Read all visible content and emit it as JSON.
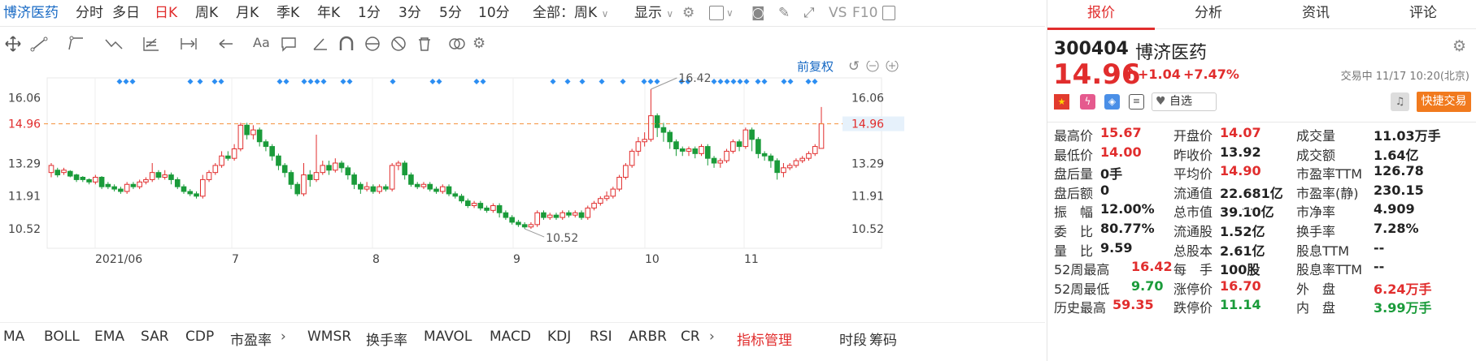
{
  "toolbar": {
    "stock_name": "博济医药",
    "periods": [
      "分时",
      "多日",
      "日K",
      "周K",
      "月K",
      "季K",
      "年K",
      "1分",
      "3分",
      "5分",
      "10分"
    ],
    "active_period": "日K",
    "all_select": "全部：周K",
    "display_label": "显示",
    "vs_label": "VS",
    "f10_label": "F10"
  },
  "chart": {
    "adjust_label": "前复权",
    "price_left": [
      "16.06",
      "14.96",
      "13.29",
      "11.91",
      "10.52"
    ],
    "price_right": [
      "16.06",
      "14.96",
      "13.29",
      "11.91",
      "10.52"
    ],
    "current_price_line": "14.96",
    "high_marker": "16.42",
    "low_marker": "10.52",
    "x_labels": [
      "2021/06",
      "7",
      "8",
      "9",
      "10",
      "11"
    ]
  },
  "chart_data": {
    "type": "candlestick",
    "current_price": 14.96,
    "ylim": [
      9.7,
      16.9
    ],
    "max_label": 16.42,
    "min_label": 10.52,
    "candles": [
      [
        12.9,
        13.2,
        13.3,
        12.7
      ],
      [
        13.0,
        12.8,
        13.1,
        12.7
      ],
      [
        12.9,
        13.0,
        13.1,
        12.8
      ],
      [
        12.95,
        12.75,
        13.0,
        12.7
      ],
      [
        12.8,
        12.6,
        12.85,
        12.5
      ],
      [
        12.7,
        12.6,
        12.75,
        12.5
      ],
      [
        12.6,
        12.5,
        12.65,
        12.4
      ],
      [
        12.5,
        12.7,
        12.8,
        12.4
      ],
      [
        12.7,
        12.3,
        12.75,
        12.2
      ],
      [
        12.4,
        12.3,
        12.5,
        12.2
      ],
      [
        12.3,
        12.2,
        12.4,
        12.1
      ],
      [
        12.2,
        12.1,
        12.3,
        12.0
      ],
      [
        12.1,
        12.4,
        12.5,
        12.0
      ],
      [
        12.4,
        12.3,
        12.5,
        12.2
      ],
      [
        12.3,
        12.5,
        12.6,
        12.2
      ],
      [
        12.5,
        12.6,
        12.7,
        12.4
      ],
      [
        12.6,
        12.9,
        13.3,
        12.5
      ],
      [
        12.9,
        12.7,
        13.0,
        12.6
      ],
      [
        12.7,
        12.8,
        13.0,
        12.6
      ],
      [
        12.8,
        12.6,
        12.9,
        12.4
      ],
      [
        12.6,
        12.3,
        12.7,
        12.2
      ],
      [
        12.3,
        12.1,
        12.4,
        12.0
      ],
      [
        12.1,
        12.0,
        12.2,
        11.9
      ],
      [
        12.0,
        11.9,
        12.1,
        11.8
      ],
      [
        11.9,
        12.6,
        12.8,
        11.8
      ],
      [
        12.6,
        12.9,
        13.0,
        12.5
      ],
      [
        12.9,
        13.2,
        13.3,
        12.8
      ],
      [
        13.2,
        13.6,
        13.8,
        13.1
      ],
      [
        13.6,
        13.5,
        13.8,
        13.4
      ],
      [
        13.5,
        13.9,
        14.1,
        13.4
      ],
      [
        13.9,
        14.9,
        15.0,
        13.8
      ],
      [
        14.9,
        14.5,
        15.0,
        14.3
      ],
      [
        14.5,
        14.7,
        14.9,
        14.3
      ],
      [
        14.7,
        14.2,
        14.8,
        14.0
      ],
      [
        14.2,
        14.0,
        14.3,
        13.8
      ],
      [
        14.0,
        13.6,
        14.1,
        13.4
      ],
      [
        13.6,
        13.2,
        13.7,
        13.0
      ],
      [
        13.2,
        12.9,
        13.3,
        12.7
      ],
      [
        12.9,
        12.4,
        13.0,
        12.2
      ],
      [
        12.4,
        12.0,
        12.5,
        11.9
      ],
      [
        12.0,
        12.8,
        13.3,
        11.9
      ],
      [
        12.8,
        12.6,
        13.0,
        12.3
      ],
      [
        12.6,
        12.9,
        14.5,
        12.5
      ],
      [
        12.9,
        13.2,
        13.4,
        12.8
      ],
      [
        13.2,
        13.0,
        13.4,
        12.8
      ],
      [
        13.0,
        13.3,
        13.5,
        12.9
      ],
      [
        13.3,
        13.1,
        13.4,
        12.9
      ],
      [
        13.1,
        12.8,
        13.2,
        12.6
      ],
      [
        12.8,
        12.4,
        12.9,
        12.2
      ],
      [
        12.4,
        12.2,
        12.5,
        12.0
      ],
      [
        12.2,
        12.3,
        12.5,
        12.1
      ],
      [
        12.3,
        12.1,
        12.4,
        12.0
      ],
      [
        12.1,
        12.3,
        12.4,
        12.0
      ],
      [
        12.3,
        12.2,
        12.4,
        12.1
      ],
      [
        12.2,
        13.2,
        13.3,
        12.1
      ],
      [
        13.2,
        13.3,
        13.4,
        13.0
      ],
      [
        13.3,
        12.8,
        13.4,
        12.6
      ],
      [
        12.8,
        12.4,
        12.9,
        12.3
      ],
      [
        12.4,
        12.3,
        12.5,
        12.2
      ],
      [
        12.3,
        12.4,
        12.5,
        12.2
      ],
      [
        12.4,
        12.2,
        12.5,
        12.1
      ],
      [
        12.2,
        12.1,
        12.3,
        12.0
      ],
      [
        12.1,
        12.3,
        12.4,
        12.0
      ],
      [
        12.3,
        12.0,
        12.4,
        11.9
      ],
      [
        12.0,
        11.9,
        12.1,
        11.8
      ],
      [
        11.9,
        11.7,
        12.0,
        11.6
      ],
      [
        11.7,
        11.5,
        11.8,
        11.4
      ],
      [
        11.5,
        11.6,
        11.7,
        11.4
      ],
      [
        11.6,
        11.4,
        11.7,
        11.3
      ],
      [
        11.4,
        11.3,
        11.5,
        11.2
      ],
      [
        11.3,
        11.5,
        11.6,
        11.2
      ],
      [
        11.5,
        11.2,
        11.6,
        11.0
      ],
      [
        11.2,
        11.0,
        11.3,
        10.9
      ],
      [
        11.0,
        10.8,
        11.1,
        10.7
      ],
      [
        10.8,
        10.7,
        10.9,
        10.6
      ],
      [
        10.7,
        10.6,
        10.8,
        10.52
      ],
      [
        10.6,
        10.7,
        10.8,
        10.52
      ],
      [
        10.7,
        11.2,
        11.3,
        10.6
      ],
      [
        11.2,
        11.0,
        11.3,
        10.9
      ],
      [
        11.0,
        11.1,
        11.2,
        10.9
      ],
      [
        11.1,
        11.0,
        11.2,
        10.9
      ],
      [
        11.0,
        11.2,
        11.3,
        10.9
      ],
      [
        11.2,
        11.1,
        11.3,
        11.0
      ],
      [
        11.1,
        11.2,
        11.3,
        11.0
      ],
      [
        11.2,
        11.0,
        11.3,
        10.9
      ],
      [
        11.0,
        11.4,
        11.5,
        10.9
      ],
      [
        11.4,
        11.6,
        11.7,
        11.3
      ],
      [
        11.6,
        11.8,
        11.9,
        11.5
      ],
      [
        11.8,
        11.9,
        12.1,
        11.7
      ],
      [
        11.9,
        12.2,
        12.3,
        11.8
      ],
      [
        12.2,
        12.7,
        12.8,
        12.1
      ],
      [
        12.7,
        13.2,
        13.3,
        12.6
      ],
      [
        13.2,
        13.8,
        13.9,
        13.1
      ],
      [
        13.8,
        14.2,
        14.4,
        13.6
      ],
      [
        14.2,
        14.3,
        14.6,
        14.0
      ],
      [
        14.3,
        15.3,
        16.42,
        14.2
      ],
      [
        15.3,
        14.8,
        15.4,
        14.4
      ],
      [
        14.8,
        14.6,
        15.0,
        14.2
      ],
      [
        14.6,
        14.2,
        14.7,
        13.9
      ],
      [
        14.2,
        13.9,
        14.3,
        13.6
      ],
      [
        13.9,
        13.8,
        14.0,
        13.6
      ],
      [
        13.8,
        13.9,
        14.0,
        13.6
      ],
      [
        13.9,
        13.7,
        14.0,
        13.5
      ],
      [
        13.7,
        14.0,
        14.1,
        13.6
      ],
      [
        14.0,
        13.5,
        14.1,
        13.2
      ],
      [
        13.5,
        13.3,
        13.6,
        13.1
      ],
      [
        13.3,
        13.4,
        13.5,
        13.1
      ],
      [
        13.4,
        13.8,
        13.9,
        13.3
      ],
      [
        13.8,
        14.2,
        14.3,
        13.7
      ],
      [
        14.2,
        14.0,
        14.3,
        13.8
      ],
      [
        14.0,
        14.7,
        14.8,
        13.9
      ],
      [
        14.7,
        14.3,
        14.8,
        13.8
      ],
      [
        14.3,
        13.7,
        14.4,
        13.5
      ],
      [
        13.7,
        13.6,
        13.8,
        13.4
      ],
      [
        13.6,
        13.4,
        13.7,
        13.1
      ],
      [
        13.4,
        12.9,
        13.5,
        12.6
      ],
      [
        12.9,
        13.1,
        13.3,
        12.7
      ],
      [
        13.1,
        13.2,
        13.3,
        13.0
      ],
      [
        13.2,
        13.4,
        13.5,
        13.1
      ],
      [
        13.4,
        13.5,
        13.6,
        13.3
      ],
      [
        13.5,
        13.7,
        13.8,
        13.4
      ],
      [
        13.7,
        14.0,
        14.1,
        13.6
      ],
      [
        13.92,
        14.96,
        15.67,
        14.0
      ]
    ]
  },
  "markers_row": "◆◆◆",
  "bottom": {
    "indicators": [
      "MA",
      "BOLL",
      "EMA",
      "SAR",
      "CDP",
      "市盈率",
      "WMSR",
      "换手率",
      "MAVOL",
      "MACD",
      "KDJ",
      "RSI",
      "ARBR",
      "CR"
    ],
    "manage_label": "指标管理",
    "right_links": [
      "时段",
      "筹码"
    ]
  },
  "right": {
    "tabs": [
      "报价",
      "分析",
      "资讯",
      "评论"
    ],
    "active_tab": "报价",
    "code": "300404",
    "name": "博济医药",
    "price": "14.96",
    "change": "+1.04",
    "change_pct": "+7.47%",
    "status_time": "交易中 11/17 10:20(北京)",
    "watch_label": "自选",
    "trade_label": "快捷交易",
    "stats": [
      [
        {
          "label": "最高价",
          "value": "15.67",
          "color": "red"
        },
        {
          "label": "开盘价",
          "value": "14.07",
          "color": "red"
        },
        {
          "label": "成交量",
          "value": "11.03万手",
          "color": "dark"
        }
      ],
      [
        {
          "label": "最低价",
          "value": "14.00",
          "color": "red"
        },
        {
          "label": "昨收价",
          "value": "13.92",
          "color": "dark"
        },
        {
          "label": "成交额",
          "value": "1.64亿",
          "color": "dark"
        }
      ],
      [
        {
          "label": "盘后量",
          "value": "0手",
          "color": "dark"
        },
        {
          "label": "平均价",
          "value": "14.90",
          "color": "red"
        },
        {
          "label": "市盈率TTM",
          "value": "126.78",
          "color": "dark"
        }
      ],
      [
        {
          "label": "盘后额",
          "value": "0",
          "color": "dark"
        },
        {
          "label": "流通值",
          "value": "22.681亿",
          "color": "dark"
        },
        {
          "label": "市盈率(静)",
          "value": "230.15",
          "color": "dark"
        }
      ],
      [
        {
          "label": "振　幅",
          "value": "12.00%",
          "color": "dark"
        },
        {
          "label": "总市值",
          "value": "39.10亿",
          "color": "dark"
        },
        {
          "label": "市净率",
          "value": "4.909",
          "color": "dark"
        }
      ],
      [
        {
          "label": "委　比",
          "value": "80.77%",
          "color": "dark"
        },
        {
          "label": "流通股",
          "value": "1.52亿",
          "color": "dark"
        },
        {
          "label": "换手率",
          "value": "7.28%",
          "color": "dark"
        }
      ],
      [
        {
          "label": "量　比",
          "value": "9.59",
          "color": "dark"
        },
        {
          "label": "总股本",
          "value": "2.61亿",
          "color": "dark"
        },
        {
          "label": "股息TTM",
          "value": "--",
          "color": "dark"
        }
      ],
      [
        {
          "label": "52周最高",
          "value": "16.42",
          "color": "red"
        },
        {
          "label": "每　手",
          "value": "100股",
          "color": "dark"
        },
        {
          "label": "股息率TTM",
          "value": "--",
          "color": "dark"
        }
      ],
      [
        {
          "label": "52周最低",
          "value": "9.70",
          "color": "green"
        },
        {
          "label": "涨停价",
          "value": "16.70",
          "color": "red"
        },
        {
          "label": "外　盘",
          "value": "6.24万手",
          "color": "red"
        }
      ],
      [
        {
          "label": "历史最高",
          "value": "59.35",
          "color": "red"
        },
        {
          "label": "跌停价",
          "value": "11.14",
          "color": "green"
        },
        {
          "label": "内　盘",
          "value": "3.99万手",
          "color": "green"
        }
      ]
    ]
  }
}
